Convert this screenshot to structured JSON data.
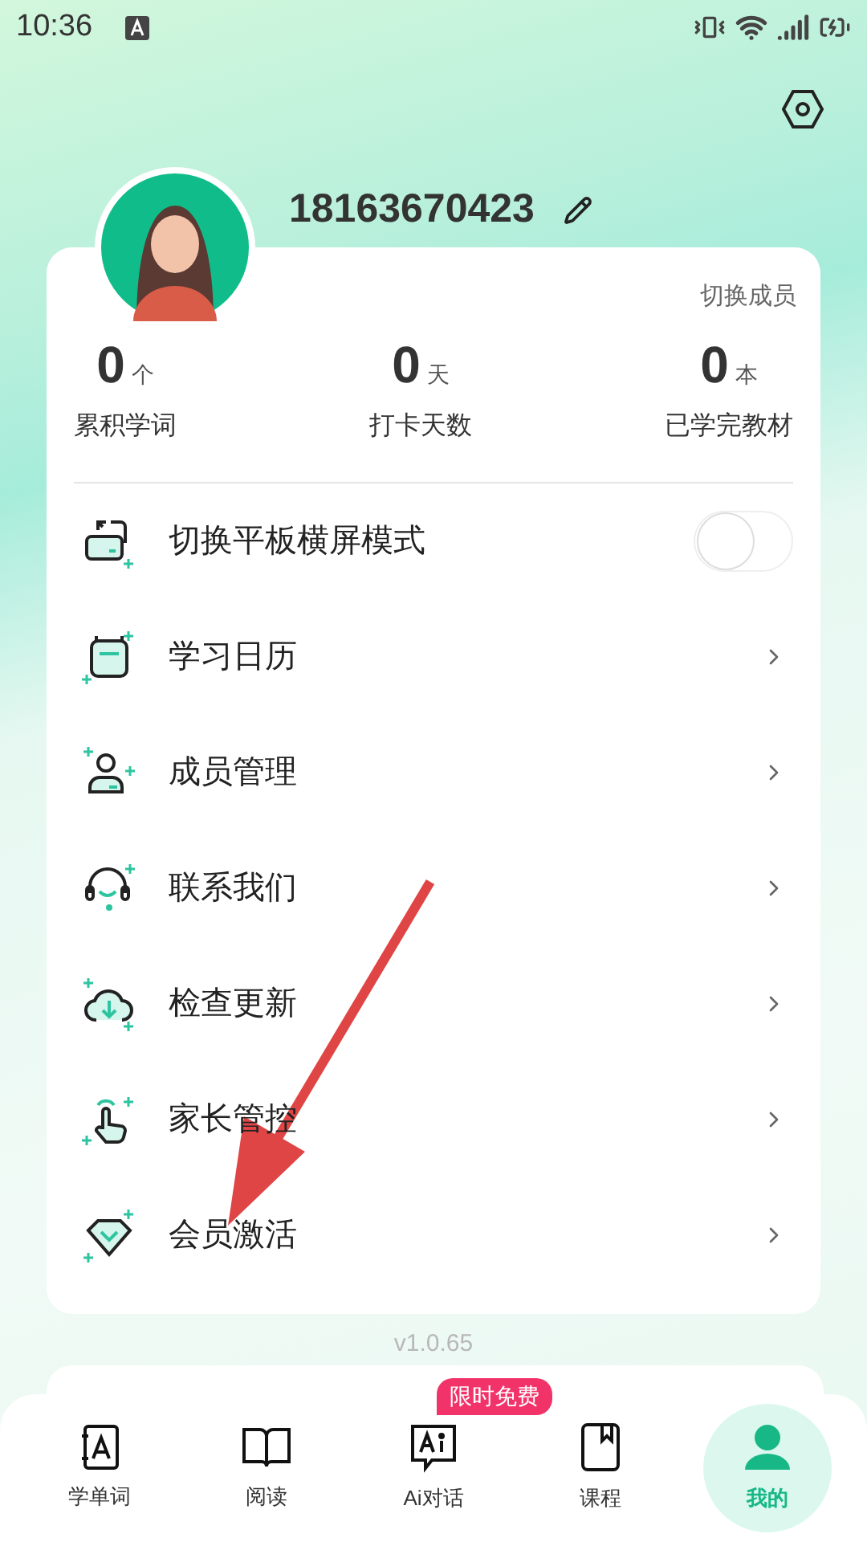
{
  "status_bar": {
    "time": "10:36"
  },
  "profile": {
    "phone": "18163670423"
  },
  "switch_member": "切换成员",
  "stats": [
    {
      "value": "0",
      "unit": "个",
      "label": "累积学词"
    },
    {
      "value": "0",
      "unit": "天",
      "label": "打卡天数"
    },
    {
      "value": "0",
      "unit": "本",
      "label": "已学完教材"
    }
  ],
  "menu": [
    {
      "kind": "toggle",
      "label": "切换平板横屏模式",
      "on": false
    },
    {
      "kind": "link",
      "label": "学习日历"
    },
    {
      "kind": "link",
      "label": "成员管理"
    },
    {
      "kind": "link",
      "label": "联系我们"
    },
    {
      "kind": "link",
      "label": "检查更新"
    },
    {
      "kind": "link",
      "label": "家长管控"
    },
    {
      "kind": "link",
      "label": "会员激活"
    }
  ],
  "version": "v1.0.65",
  "nav": [
    {
      "label": "学单词",
      "selected": false
    },
    {
      "label": "阅读",
      "selected": false
    },
    {
      "label": "Ai对话",
      "selected": false,
      "badge": "限时免费"
    },
    {
      "label": "课程",
      "selected": false
    },
    {
      "label": "我的",
      "selected": true
    }
  ]
}
